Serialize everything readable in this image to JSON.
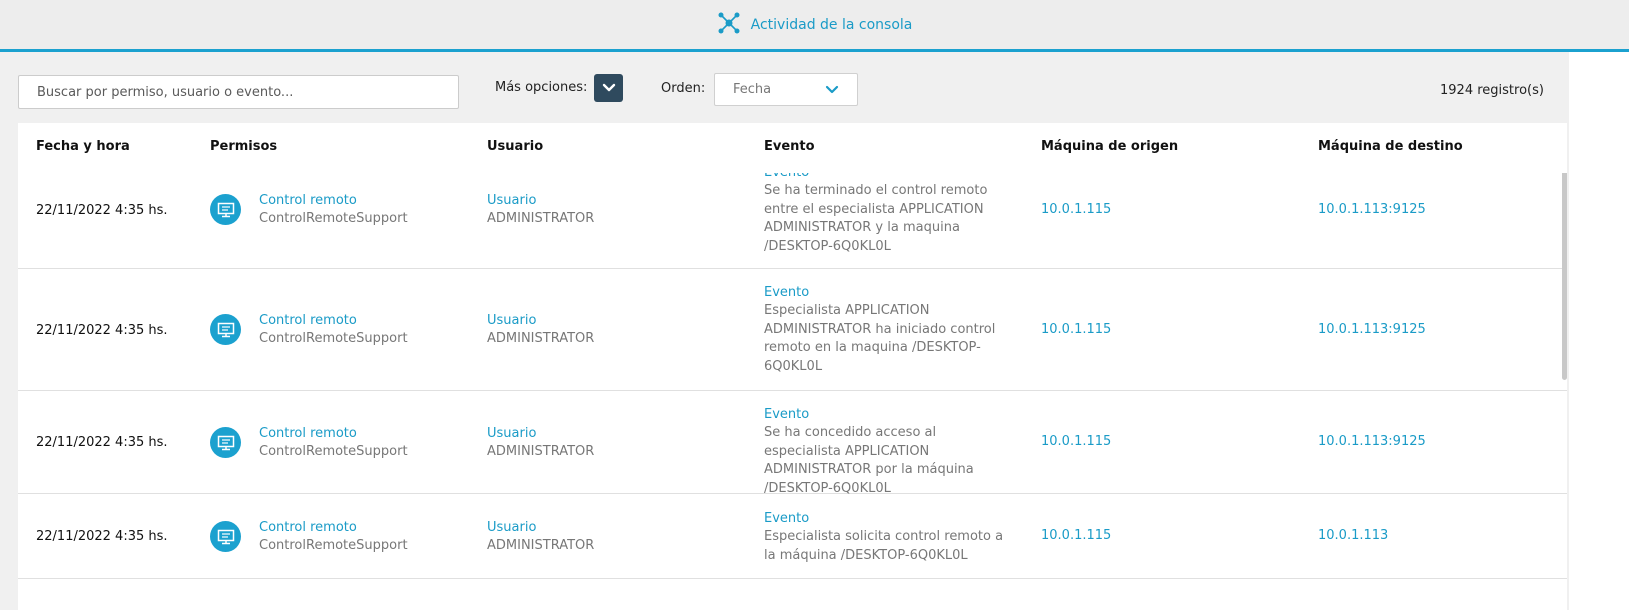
{
  "header": {
    "title": "Actividad de la consola",
    "icon": "network-nodes-icon"
  },
  "toolbar": {
    "search_placeholder": "Buscar por permiso, usuario o evento...",
    "more_options_label": "Más opciones:",
    "order_label": "Orden:",
    "order_value": "Fecha",
    "record_count": "1924 registro(s)"
  },
  "table": {
    "columns": [
      "Fecha y hora",
      "Permisos",
      "Usuario",
      "Evento",
      "Máquina de origen",
      "Máquina de destino"
    ],
    "rows": [
      {
        "date": "22/11/2022 4:35 hs.",
        "perm_title": "Control remoto",
        "perm_sub": "ControlRemoteSupport",
        "user_title": "Usuario",
        "user_sub": "ADMINISTRATOR",
        "event_title": "Evento",
        "event_text": "Se ha terminado el control remoto entre el especialista APPLICATION ADMINISTRATOR y la maquina /DESKTOP-6Q0KL0L",
        "origin": "10.0.1.115",
        "dest": "10.0.1.113:9125"
      },
      {
        "date": "22/11/2022 4:35 hs.",
        "perm_title": "Control remoto",
        "perm_sub": "ControlRemoteSupport",
        "user_title": "Usuario",
        "user_sub": "ADMINISTRATOR",
        "event_title": "Evento",
        "event_text": "Especialista APPLICATION ADMINISTRATOR ha iniciado control remoto en la maquina /DESKTOP-6Q0KL0L",
        "origin": "10.0.1.115",
        "dest": "10.0.1.113:9125"
      },
      {
        "date": "22/11/2022 4:35 hs.",
        "perm_title": "Control remoto",
        "perm_sub": "ControlRemoteSupport",
        "user_title": "Usuario",
        "user_sub": "ADMINISTRATOR",
        "event_title": "Evento",
        "event_text": "Se ha concedido acceso al especialista APPLICATION ADMINISTRATOR por la máquina /DESKTOP-6Q0KL0L",
        "origin": "10.0.1.115",
        "dest": "10.0.1.113:9125"
      },
      {
        "date": "22/11/2022 4:35 hs.",
        "perm_title": "Control remoto",
        "perm_sub": "ControlRemoteSupport",
        "user_title": "Usuario",
        "user_sub": "ADMINISTRATOR",
        "event_title": "Evento",
        "event_text": "Especialista solicita control remoto a la máquina /DESKTOP-6Q0KL0L",
        "origin": "10.0.1.115",
        "dest": "10.0.1.113"
      }
    ]
  },
  "colors": {
    "accent": "#1ba1cf",
    "dark_button": "#2f4a5e"
  }
}
